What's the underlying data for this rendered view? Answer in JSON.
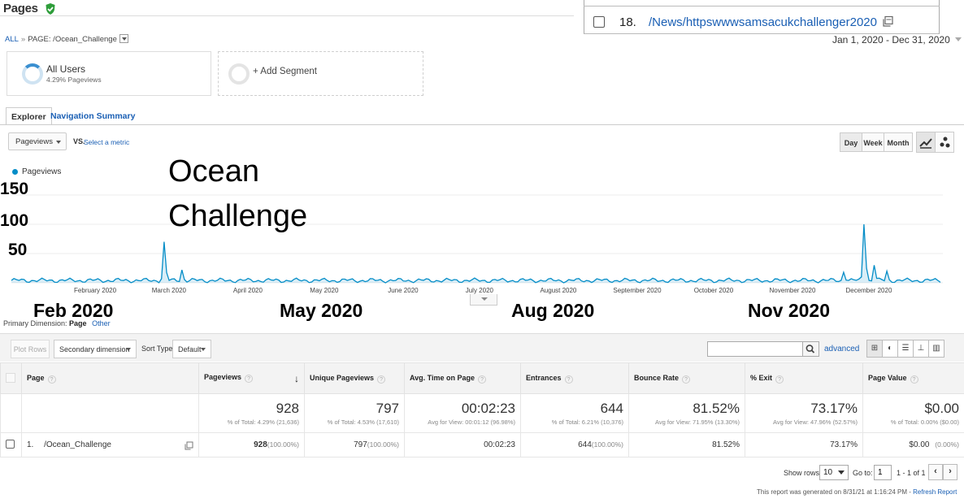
{
  "header": {
    "title": "Pages",
    "badge_icon": "verified-check-icon"
  },
  "breadcrumb": {
    "root": "ALL",
    "sep": "»",
    "current": "PAGE: /Ocean_Challenge"
  },
  "overlay_row": {
    "rank": "18.",
    "path": "/News/httpswwwsamsacukchallenger2020",
    "icon": "open-new-window-icon"
  },
  "date_range": "Jan 1, 2020 - Dec 31, 2020",
  "segments": {
    "all_users": {
      "name": "All Users",
      "stat": "4.29% Pageviews"
    },
    "add_label": "+ Add Segment"
  },
  "tabs": [
    {
      "label": "Explorer",
      "active": true
    },
    {
      "label": "Navigation Summary",
      "active": false
    }
  ],
  "chart_controls": {
    "metric": "Pageviews",
    "vs": "VS.",
    "select_metric": "Select a metric",
    "granularity": [
      "Day",
      "Week",
      "Month"
    ],
    "selected_granularity": "Day"
  },
  "chart_data": {
    "type": "area",
    "legend": [
      "Pageviews"
    ],
    "color": "#058dc7",
    "ylim": [
      0,
      150
    ],
    "y_ticks": [
      "150",
      "100",
      "50"
    ],
    "x_ticks": [
      "February 2020",
      "March 2020",
      "April 2020",
      "May 2020",
      "June 2020",
      "July 2020",
      "August 2020",
      "September 2020",
      "October 2020",
      "November 2020",
      "December 2020"
    ],
    "annotations": [
      "Ocean",
      "Challenge"
    ],
    "big_x_labels": [
      "Feb 2020",
      "May 2020",
      "Aug 2020",
      "Nov 2020"
    ],
    "series": [
      {
        "name": "Pageviews",
        "peaks": [
          {
            "date": "2020-03-01",
            "value": 70
          },
          {
            "date": "2020-03-08",
            "value": 22
          },
          {
            "date": "2020-11-23",
            "value": 18
          },
          {
            "date": "2020-12-01",
            "value": 100
          },
          {
            "date": "2020-12-05",
            "value": 30
          },
          {
            "date": "2020-12-10",
            "value": 20
          }
        ],
        "baseline_range": [
          0,
          8
        ]
      }
    ]
  },
  "primary_dimension": {
    "label": "Primary Dimension:",
    "value": "Page",
    "other": "Other"
  },
  "toolbar": {
    "plot_rows": "Plot Rows",
    "secondary_dimension": "Secondary dimension",
    "sort_label": "Sort Type:",
    "sort_value": "Default",
    "advanced": "advanced"
  },
  "table": {
    "columns": [
      "Page",
      "Pageviews",
      "Unique Pageviews",
      "Avg. Time on Page",
      "Entrances",
      "Bounce Rate",
      "% Exit",
      "Page Value"
    ],
    "totals": [
      {
        "main": "928",
        "sub": "% of Total: 4.29% (21,636)"
      },
      {
        "main": "797",
        "sub": "% of Total: 4.53% (17,610)"
      },
      {
        "main": "00:02:23",
        "sub": "Avg for View: 00:01:12 (96.98%)"
      },
      {
        "main": "644",
        "sub": "% of Total: 6.21% (10,376)"
      },
      {
        "main": "81.52%",
        "sub": "Avg for View: 71.95% (13.30%)"
      },
      {
        "main": "73.17%",
        "sub": "Avg for View: 47.96% (52.57%)"
      },
      {
        "main": "$0.00",
        "sub": "% of Total: 0.00% ($0.00)"
      }
    ],
    "row": {
      "index": "1.",
      "page": "/Ocean_Challenge",
      "pageviews": "928",
      "pageviews_pct": "(100.00%)",
      "unique": "797",
      "unique_pct": "(100.00%)",
      "avg_time": "00:02:23",
      "entrances": "644",
      "entrances_pct": "(100.00%)",
      "bounce": "81.52%",
      "exit": "73.17%",
      "value": "$0.00",
      "value_pct": "(0.00%)"
    }
  },
  "pagination": {
    "show_rows_label": "Show rows:",
    "rows_value": "10",
    "goto_label": "Go to:",
    "goto_value": "1",
    "range": "1 - 1 of 1",
    "prev": "‹",
    "next": "›"
  },
  "report_note": {
    "text": "This report was generated on 8/31/21 at 1:16:24 PM - ",
    "link": "Refresh Report"
  }
}
